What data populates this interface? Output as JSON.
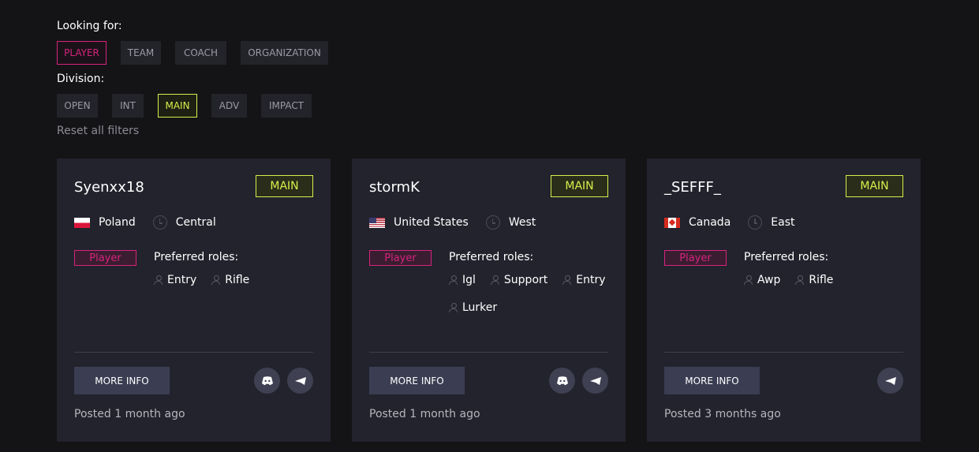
{
  "filters": {
    "looking_for_label": "Looking for:",
    "looking_for_options": [
      "PLAYER",
      "TEAM",
      "COACH",
      "ORGANIZATION"
    ],
    "looking_for_selected": "PLAYER",
    "division_label": "Division:",
    "division_options": [
      "OPEN",
      "INT",
      "MAIN",
      "ADV",
      "IMPACT"
    ],
    "division_selected": "MAIN",
    "reset_label": "Reset all filters"
  },
  "colors": {
    "accent_pink": "#d6247e",
    "accent_lime": "#d8ee4b",
    "card_bg": "#22232d",
    "page_bg": "#141417"
  },
  "cards": [
    {
      "name": "Syenxx18",
      "division": "MAIN",
      "country": "Poland",
      "flag": "poland-flag-icon",
      "timezone": "Central",
      "type": "Player",
      "preferred_roles_label": "Preferred roles:",
      "roles": [
        "Entry",
        "Rifle"
      ],
      "more_info_label": "MORE INFO",
      "actions": [
        "discord-icon",
        "telegram-icon"
      ],
      "posted": "Posted 1 month ago"
    },
    {
      "name": "stormK",
      "division": "MAIN",
      "country": "United States",
      "flag": "us-flag-icon",
      "timezone": "West",
      "type": "Player",
      "preferred_roles_label": "Preferred roles:",
      "roles": [
        "Igl",
        "Support",
        "Entry",
        "Lurker"
      ],
      "more_info_label": "MORE INFO",
      "actions": [
        "discord-icon",
        "telegram-icon"
      ],
      "posted": "Posted 1 month ago"
    },
    {
      "name": "_SEFFF_",
      "division": "MAIN",
      "country": "Canada",
      "flag": "canada-flag-icon",
      "timezone": "East",
      "type": "Player",
      "preferred_roles_label": "Preferred roles:",
      "roles": [
        "Awp",
        "Rifle"
      ],
      "more_info_label": "MORE INFO",
      "actions": [
        "telegram-icon"
      ],
      "posted": "Posted 3 months ago"
    }
  ]
}
